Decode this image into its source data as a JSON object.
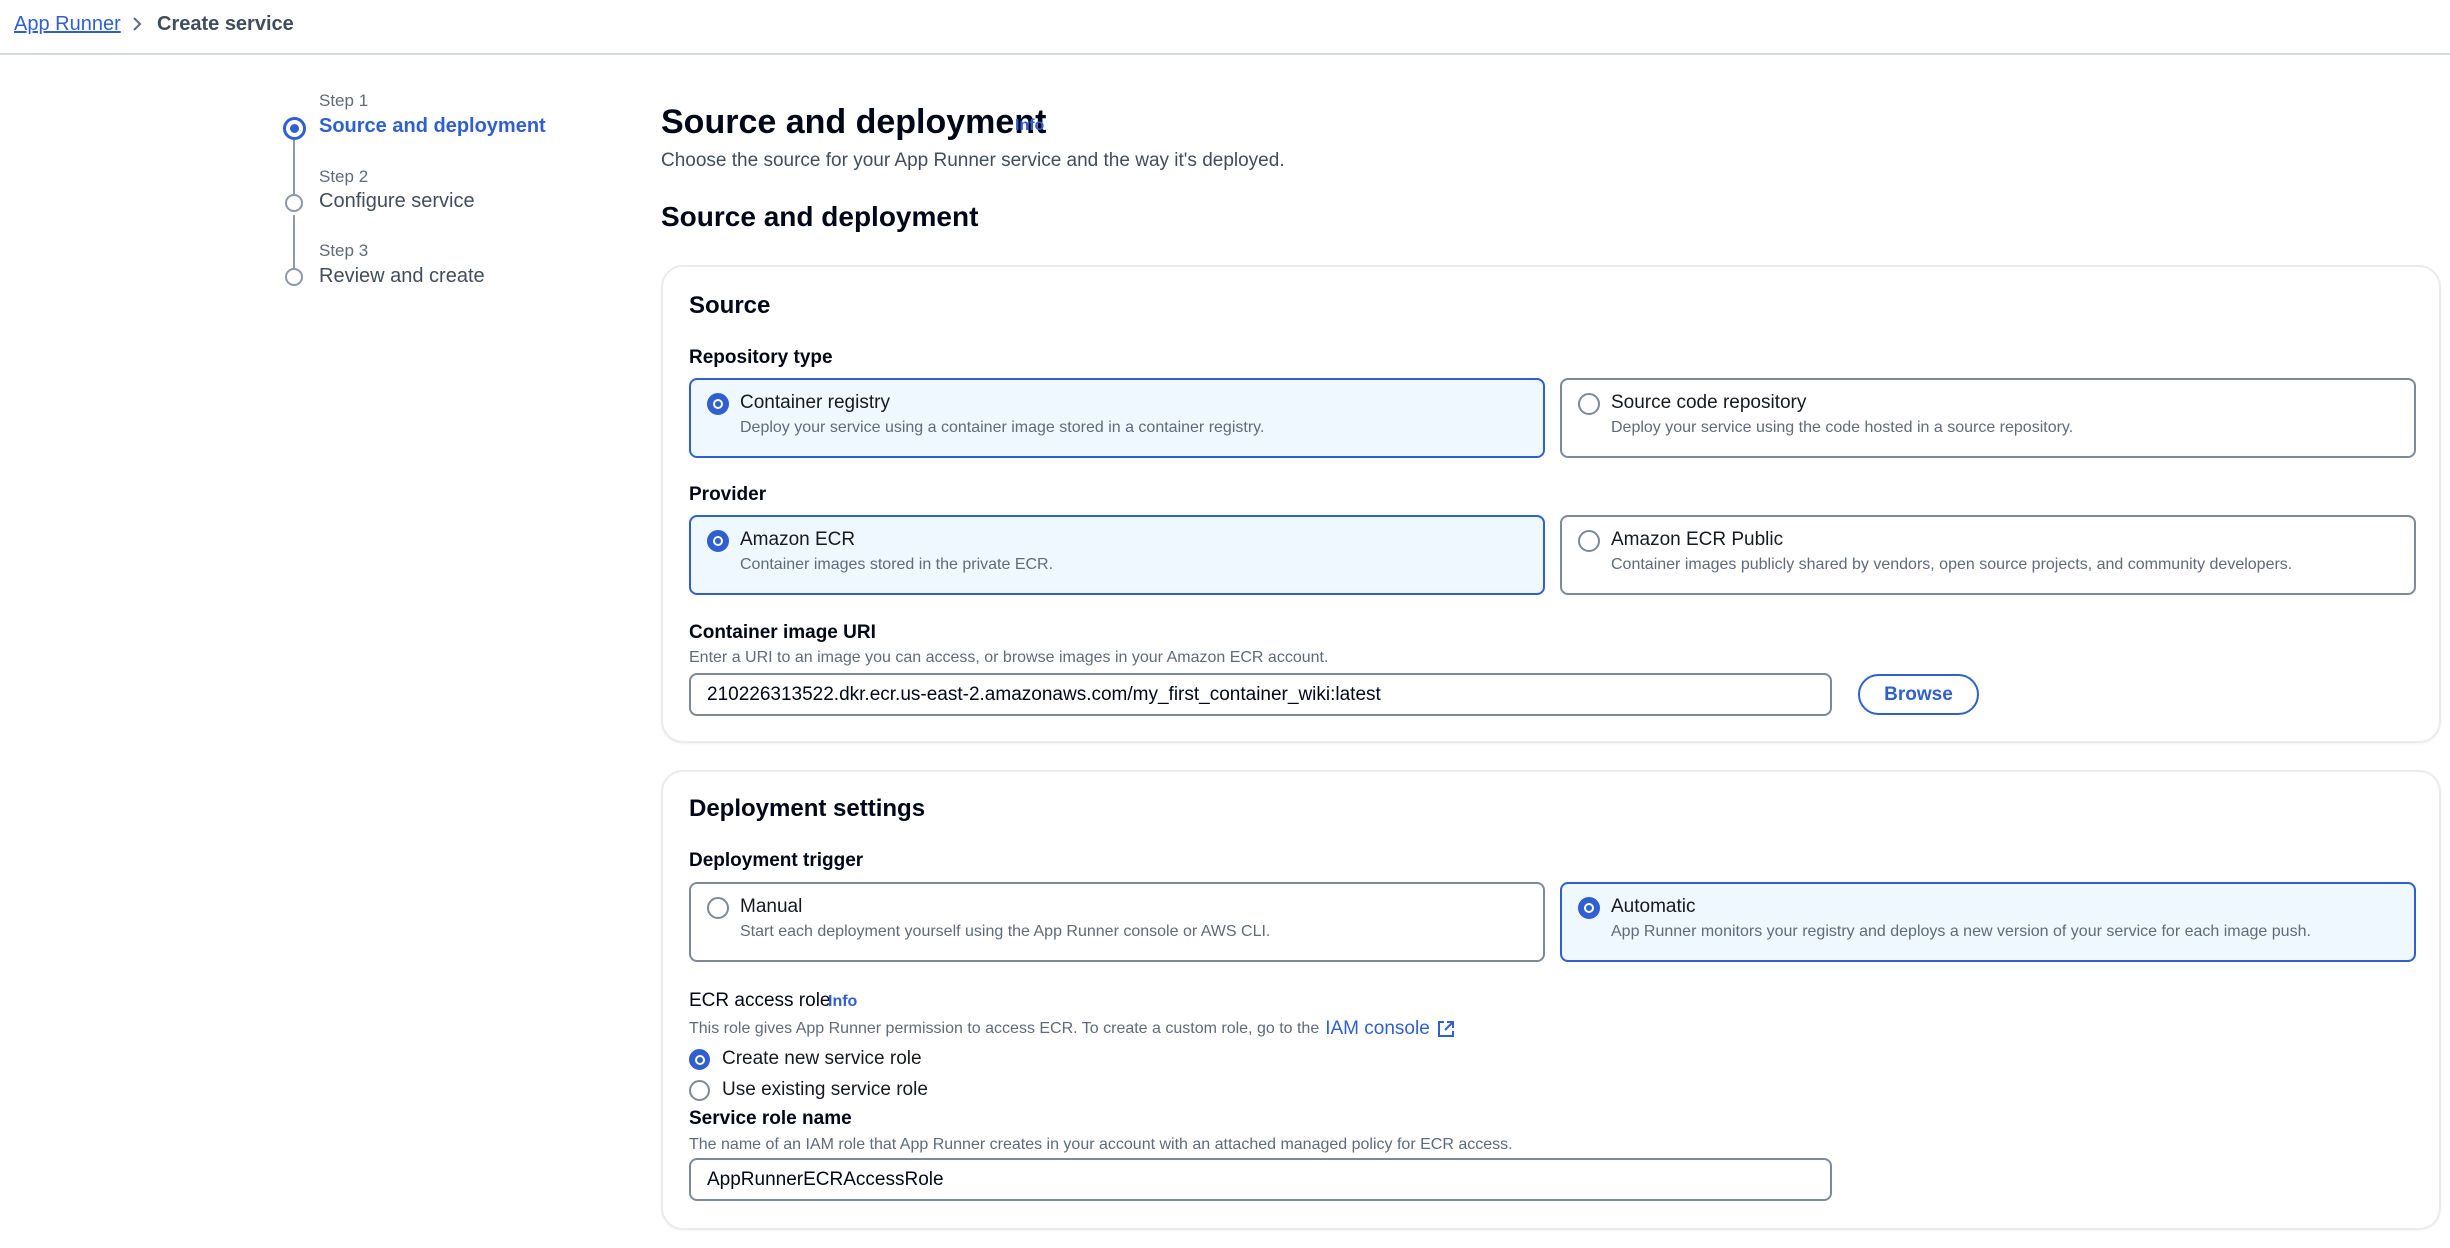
{
  "breadcrumb": {
    "root": "App Runner",
    "current": "Create service"
  },
  "steps": [
    {
      "small": "Step 1",
      "label": "Source and deployment",
      "active": true
    },
    {
      "small": "Step 2",
      "label": "Configure service",
      "active": false
    },
    {
      "small": "Step 3",
      "label": "Review and create",
      "active": false
    }
  ],
  "page": {
    "title": "Source and deployment",
    "info": "Info",
    "description": "Choose the source for your App Runner service and the way it's deployed.",
    "section_heading": "Source and deployment"
  },
  "source": {
    "title": "Source",
    "repo_type_label": "Repository type",
    "repo_types": [
      {
        "title": "Container registry",
        "desc": "Deploy your service using a container image stored in a container registry.",
        "selected": true
      },
      {
        "title": "Source code repository",
        "desc": "Deploy your service using the code hosted in a source repository.",
        "selected": false
      }
    ],
    "provider_label": "Provider",
    "providers": [
      {
        "title": "Amazon ECR",
        "desc": "Container images stored in the private ECR.",
        "selected": true
      },
      {
        "title": "Amazon ECR Public",
        "desc": "Container images publicly shared by vendors, open source projects, and community developers.",
        "selected": false
      }
    ],
    "uri_label": "Container image URI",
    "uri_desc": "Enter a URI to an image you can access, or browse images in your Amazon ECR account.",
    "uri_value": "210226313522.dkr.ecr.us-east-2.amazonaws.com/my_first_container_wiki:latest",
    "browse_label": "Browse"
  },
  "deployment": {
    "title": "Deployment settings",
    "trigger_label": "Deployment trigger",
    "triggers": [
      {
        "title": "Manual",
        "desc": "Start each deployment yourself using the App Runner console or AWS CLI.",
        "selected": false
      },
      {
        "title": "Automatic",
        "desc": "App Runner monitors your registry and deploys a new version of your service for each image push.",
        "selected": true
      }
    ],
    "role_label": "ECR access role",
    "role_info": "Info",
    "role_desc": "This role gives App Runner permission to access ECR. To create a custom role, go to the",
    "iam_link": "IAM console",
    "role_options": [
      {
        "label": "Create new service role",
        "checked": true
      },
      {
        "label": "Use existing service role",
        "checked": false
      }
    ],
    "service_role_label": "Service role name",
    "service_role_desc": "The name of an IAM role that App Runner creates in your account with an attached managed policy for ECR access.",
    "service_role_value": "AppRunnerECRAccessRole"
  },
  "colors": {
    "accent": "#2f5fd0",
    "selected_tile_bg": "#f0f8ff",
    "border": "#7d8998"
  }
}
